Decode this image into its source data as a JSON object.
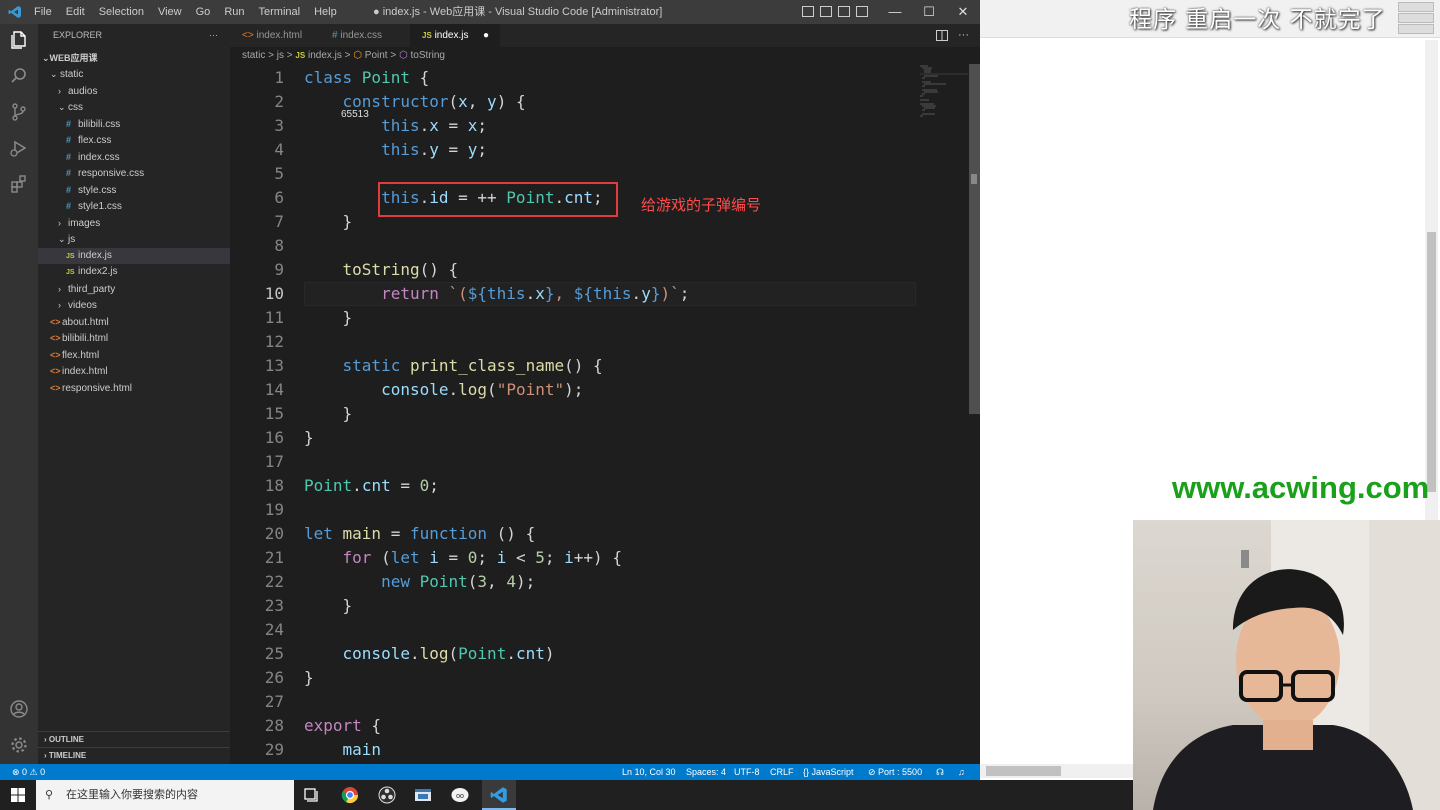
{
  "titlebar": {
    "menu": [
      "File",
      "Edit",
      "Selection",
      "View",
      "Go",
      "Run",
      "Terminal",
      "Help"
    ],
    "title": "● index.js - Web应用课 - Visual Studio Code [Administrator]",
    "controls": [
      "—",
      "☐",
      "✕"
    ]
  },
  "explorer": {
    "header": "EXPLORER",
    "more": "···",
    "root": "WEB应用课",
    "tree": [
      {
        "label": "static",
        "type": "folder",
        "open": true,
        "depth": 1
      },
      {
        "label": "audios",
        "type": "folder",
        "open": false,
        "depth": 2
      },
      {
        "label": "css",
        "type": "folder",
        "open": true,
        "depth": 2
      },
      {
        "label": "bilibili.css",
        "type": "css",
        "depth": 3
      },
      {
        "label": "flex.css",
        "type": "css",
        "depth": 3
      },
      {
        "label": "index.css",
        "type": "css",
        "depth": 3
      },
      {
        "label": "responsive.css",
        "type": "css",
        "depth": 3
      },
      {
        "label": "style.css",
        "type": "css",
        "depth": 3
      },
      {
        "label": "style1.css",
        "type": "css",
        "depth": 3
      },
      {
        "label": "images",
        "type": "folder",
        "open": false,
        "depth": 2
      },
      {
        "label": "js",
        "type": "folder",
        "open": true,
        "depth": 2
      },
      {
        "label": "index.js",
        "type": "js",
        "depth": 3,
        "selected": true
      },
      {
        "label": "index2.js",
        "type": "js",
        "depth": 3
      },
      {
        "label": "third_party",
        "type": "folder",
        "open": false,
        "depth": 2
      },
      {
        "label": "videos",
        "type": "folder",
        "open": false,
        "depth": 2
      },
      {
        "label": "about.html",
        "type": "html",
        "depth": 1
      },
      {
        "label": "bilibili.html",
        "type": "html",
        "depth": 1
      },
      {
        "label": "flex.html",
        "type": "html",
        "depth": 1
      },
      {
        "label": "index.html",
        "type": "html",
        "depth": 1
      },
      {
        "label": "responsive.html",
        "type": "html",
        "depth": 1
      }
    ],
    "outline": "OUTLINE",
    "timeline": "TIMELINE"
  },
  "tabs": [
    {
      "label": "index.html",
      "icon": "<>"
    },
    {
      "label": "index.css",
      "icon": "#"
    },
    {
      "label": "index.js",
      "icon": "JS",
      "active": true,
      "dirty": "●"
    }
  ],
  "breadcrumb": [
    "static",
    ">",
    "js",
    ">",
    "JS",
    "index.js",
    ">",
    "Point",
    ">",
    "toString"
  ],
  "editor": {
    "current_line": 10,
    "inlay_hint": "65513",
    "annotation": "给游戏的子弹编号",
    "lines": [
      [
        [
          "kw",
          "class "
        ],
        [
          "cl",
          "Point"
        ],
        [
          "pu",
          " {"
        ]
      ],
      [
        [
          "pu",
          "    "
        ],
        [
          "kw",
          "constructor"
        ],
        [
          "pu",
          "("
        ],
        [
          "pa",
          "x"
        ],
        [
          "pu",
          ", "
        ],
        [
          "pa",
          "y"
        ],
        [
          "pu",
          ") {"
        ]
      ],
      [
        [
          "pu",
          "        "
        ],
        [
          "kw",
          "this"
        ],
        [
          "pu",
          "."
        ],
        [
          "pa",
          "x"
        ],
        [
          "pu",
          " = "
        ],
        [
          "pa",
          "x"
        ],
        [
          "pu",
          ";"
        ]
      ],
      [
        [
          "pu",
          "        "
        ],
        [
          "kw",
          "this"
        ],
        [
          "pu",
          "."
        ],
        [
          "pa",
          "y"
        ],
        [
          "pu",
          " = "
        ],
        [
          "pa",
          "y"
        ],
        [
          "pu",
          ";"
        ]
      ],
      [
        [
          "pu",
          ""
        ]
      ],
      [
        [
          "pu",
          "        "
        ],
        [
          "kw",
          "this"
        ],
        [
          "pu",
          "."
        ],
        [
          "pa",
          "id"
        ],
        [
          "pu",
          " = ++ "
        ],
        [
          "cl",
          "Point"
        ],
        [
          "pu",
          "."
        ],
        [
          "pa",
          "cnt"
        ],
        [
          "pu",
          ";"
        ]
      ],
      [
        [
          "pu",
          "    }"
        ]
      ],
      [
        [
          "pu",
          ""
        ]
      ],
      [
        [
          "pu",
          "    "
        ],
        [
          "fn",
          "toString"
        ],
        [
          "pu",
          "() {"
        ]
      ],
      [
        [
          "pu",
          "        "
        ],
        [
          "kw2",
          "return"
        ],
        [
          "pu",
          " "
        ],
        [
          "st",
          "`("
        ],
        [
          "kw",
          "${"
        ],
        [
          "kw",
          "this"
        ],
        [
          "pu",
          "."
        ],
        [
          "pa",
          "x"
        ],
        [
          "kw",
          "}"
        ],
        [
          "st",
          ", "
        ],
        [
          "kw",
          "${"
        ],
        [
          "kw",
          "this"
        ],
        [
          "pu",
          "."
        ],
        [
          "pa",
          "y"
        ],
        [
          "kw",
          "}"
        ],
        [
          "st",
          ")`"
        ],
        [
          "pu",
          ";"
        ]
      ],
      [
        [
          "pu",
          "    }"
        ]
      ],
      [
        [
          "pu",
          ""
        ]
      ],
      [
        [
          "pu",
          "    "
        ],
        [
          "kw",
          "static"
        ],
        [
          "pu",
          " "
        ],
        [
          "fn",
          "print_class_name"
        ],
        [
          "pu",
          "() {"
        ]
      ],
      [
        [
          "pu",
          "        "
        ],
        [
          "pa",
          "console"
        ],
        [
          "pu",
          "."
        ],
        [
          "fn",
          "log"
        ],
        [
          "pu",
          "("
        ],
        [
          "st",
          "\"Point\""
        ],
        [
          "pu",
          ");"
        ]
      ],
      [
        [
          "pu",
          "    }"
        ]
      ],
      [
        [
          "pu",
          "}"
        ]
      ],
      [
        [
          "pu",
          ""
        ]
      ],
      [
        [
          "cl",
          "Point"
        ],
        [
          "pu",
          "."
        ],
        [
          "pa",
          "cnt"
        ],
        [
          "pu",
          " = "
        ],
        [
          "nu",
          "0"
        ],
        [
          "pu",
          ";"
        ]
      ],
      [
        [
          "pu",
          ""
        ]
      ],
      [
        [
          "kw",
          "let "
        ],
        [
          "fn",
          "main"
        ],
        [
          "pu",
          " = "
        ],
        [
          "kw",
          "function"
        ],
        [
          "pu",
          " () {"
        ]
      ],
      [
        [
          "pu",
          "    "
        ],
        [
          "kw2",
          "for"
        ],
        [
          "pu",
          " ("
        ],
        [
          "kw",
          "let "
        ],
        [
          "pa",
          "i"
        ],
        [
          "pu",
          " = "
        ],
        [
          "nu",
          "0"
        ],
        [
          "pu",
          "; "
        ],
        [
          "pa",
          "i"
        ],
        [
          "pu",
          " < "
        ],
        [
          "nu",
          "5"
        ],
        [
          "pu",
          "; "
        ],
        [
          "pa",
          "i"
        ],
        [
          "pu",
          "++) {"
        ]
      ],
      [
        [
          "pu",
          "        "
        ],
        [
          "kw",
          "new "
        ],
        [
          "cl",
          "Point"
        ],
        [
          "pu",
          "("
        ],
        [
          "nu",
          "3"
        ],
        [
          "pu",
          ", "
        ],
        [
          "nu",
          "4"
        ],
        [
          "pu",
          ");"
        ]
      ],
      [
        [
          "pu",
          "    }"
        ]
      ],
      [
        [
          "pu",
          ""
        ]
      ],
      [
        [
          "pu",
          "    "
        ],
        [
          "pa",
          "console"
        ],
        [
          "pu",
          "."
        ],
        [
          "fn",
          "log"
        ],
        [
          "pu",
          "("
        ],
        [
          "cl",
          "Point"
        ],
        [
          "pu",
          "."
        ],
        [
          "pa",
          "cnt"
        ],
        [
          "pu",
          ")"
        ]
      ],
      [
        [
          "pu",
          "}"
        ]
      ],
      [
        [
          "pu",
          ""
        ]
      ],
      [
        [
          "kw2",
          "export"
        ],
        [
          "pu",
          " {"
        ]
      ],
      [
        [
          "pu",
          "    "
        ],
        [
          "pa",
          "main"
        ]
      ]
    ]
  },
  "statusbar": {
    "problems": "⊗ 0 ⚠ 0",
    "position": "Ln 10, Col 30",
    "spaces": "Spaces: 4",
    "encoding": "UTF-8",
    "eol": "CRLF",
    "language": "{} JavaScript",
    "port": "⊘ Port : 5500"
  },
  "overlay": {
    "slogan": "程序  重启一次  不就完了",
    "site": "www.acwing.com"
  },
  "taskbar": {
    "search_placeholder": "在这里输入你要搜索的内容"
  }
}
